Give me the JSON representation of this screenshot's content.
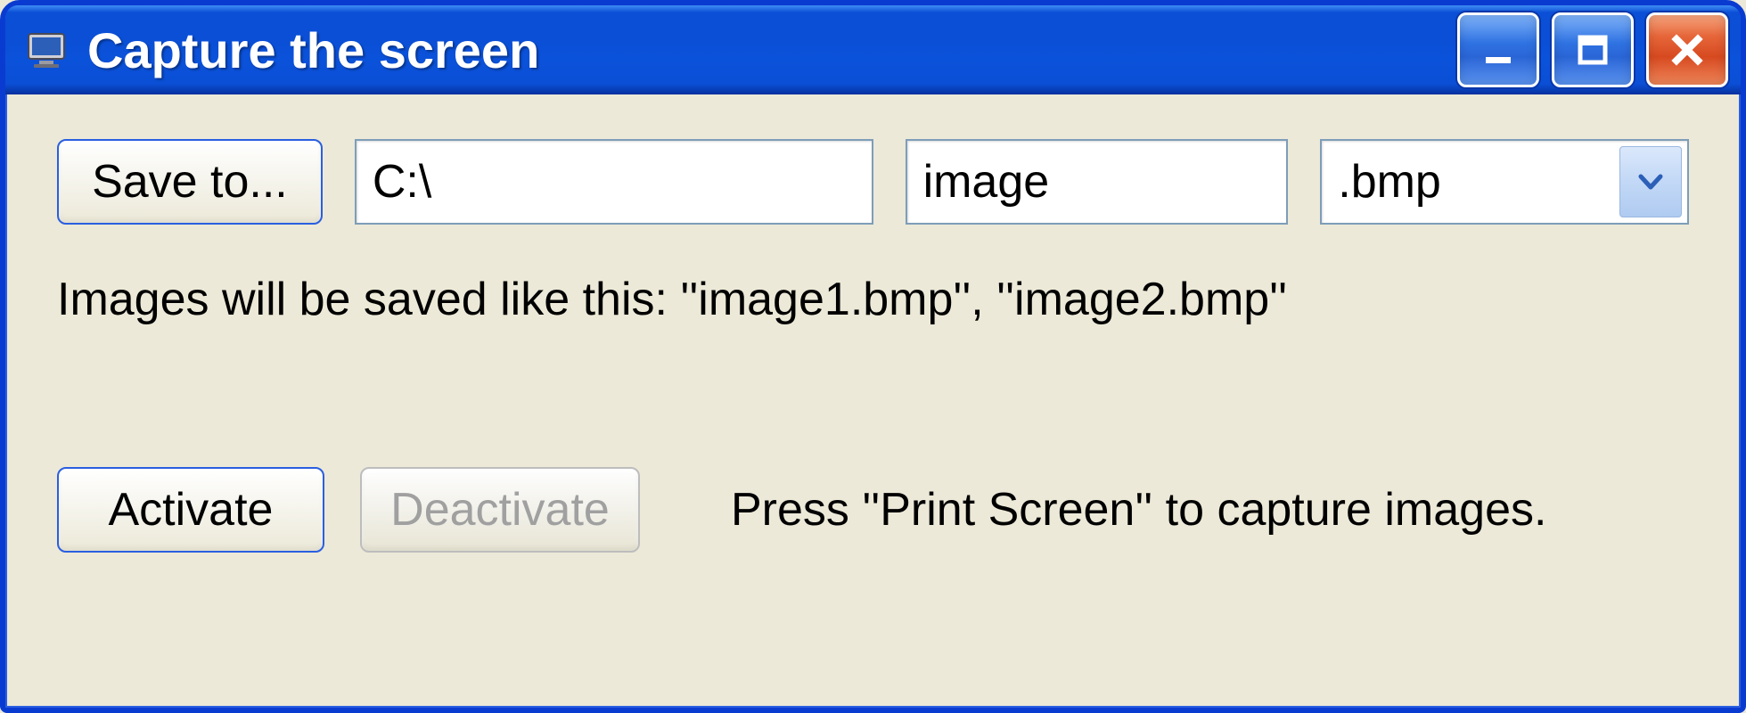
{
  "window": {
    "title": "Capture the screen",
    "icon": "monitor-icon"
  },
  "controls": {
    "minimize": "minimize-icon",
    "maximize": "maximize-icon",
    "close": "close-icon"
  },
  "form": {
    "saveTo": {
      "label": "Save to..."
    },
    "path": {
      "value": "C:\\"
    },
    "name": {
      "value": "image"
    },
    "ext": {
      "value": ".bmp"
    },
    "hint": "Images will be saved like this: ''image1.bmp'', ''image2.bmp''",
    "activate": {
      "label": "Activate",
      "enabled": true
    },
    "deactivate": {
      "label": "Deactivate",
      "enabled": false
    },
    "instruction": "Press ''Print Screen'' to capture images."
  }
}
